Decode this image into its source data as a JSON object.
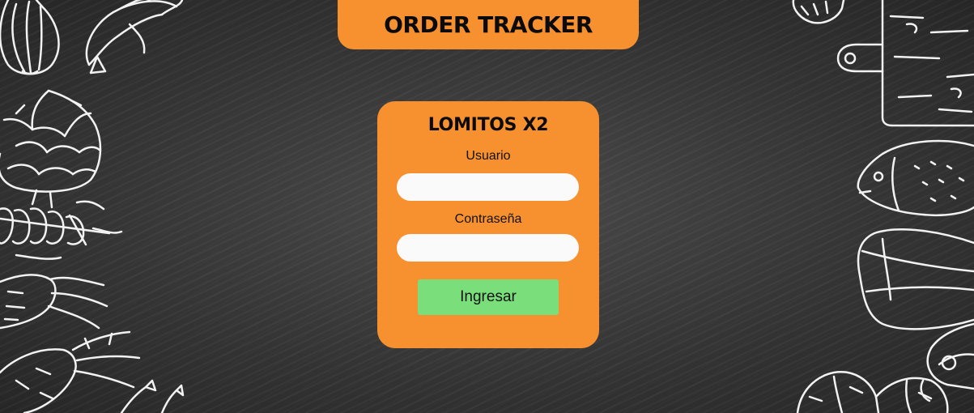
{
  "header": {
    "title": "ORDER TRACKER"
  },
  "login": {
    "brand": "LOMITOS X2",
    "username_label": "Usuario",
    "username_value": "",
    "password_label": "Contraseña",
    "password_value": "",
    "submit_label": "Ingresar"
  },
  "colors": {
    "accent": "#f7902f",
    "button": "#7adf7a",
    "input_bg": "#fafafa",
    "background": "#3a3a3a"
  },
  "decorations": {
    "left": [
      "garlic-icon",
      "banana-icon",
      "artichoke-icon",
      "skewer-icon",
      "carrot-icon",
      "carrot-icon",
      "asparagus-icon"
    ],
    "right": [
      "shrimp-icon",
      "cutting-board-icon",
      "fish-icon",
      "bok-choy-icon",
      "mushroom-icon",
      "spinach-icon"
    ]
  }
}
